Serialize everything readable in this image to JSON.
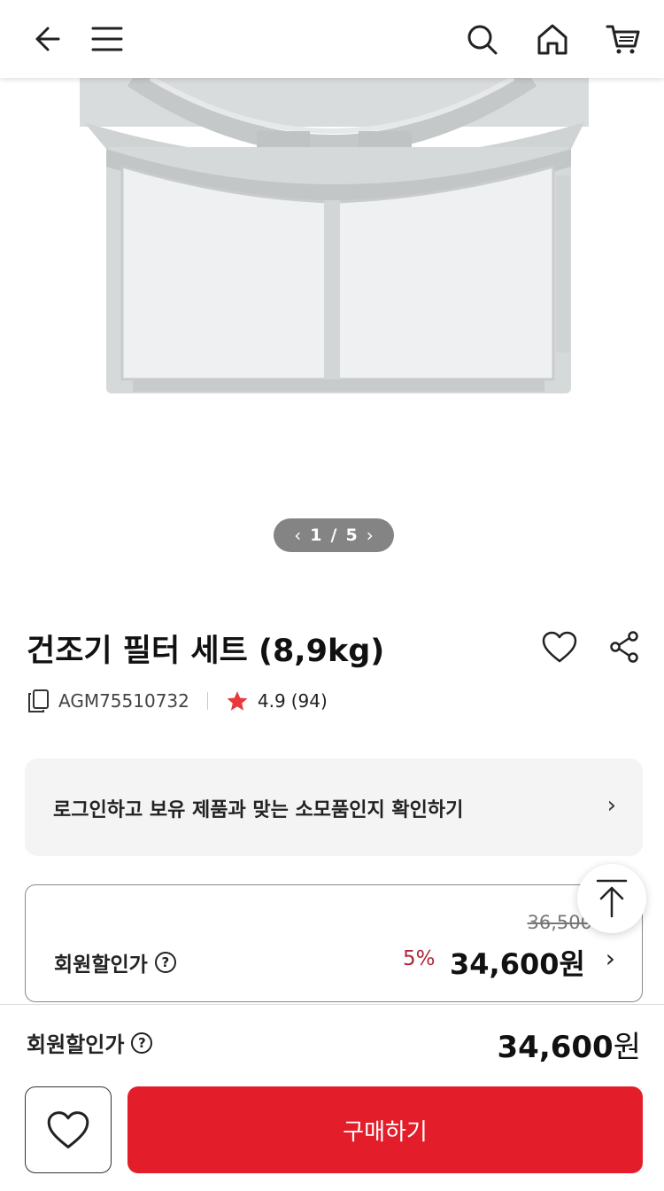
{
  "header": {
    "back_icon": "arrow-left-icon",
    "menu_icon": "hamburger-menu-icon",
    "search_icon": "search-icon",
    "home_icon": "home-icon",
    "cart_icon": "cart-icon"
  },
  "gallery": {
    "current": "1",
    "separator": "/",
    "total": "5",
    "prev": "‹",
    "next": "›"
  },
  "product": {
    "title": "건조기 필터 세트 (8,9kg)",
    "model_code": "AGM75510732",
    "rating": "4.9",
    "review_count": "(94)",
    "star_color": "#e8393f"
  },
  "login_banner": {
    "text": "로그인하고 보유 제품과 맞는 소모품인지 확인하기",
    "chevron": "›"
  },
  "price_card": {
    "original_price": "36,500",
    "label": "회원할인가",
    "help": "?",
    "discount_rate": "5%",
    "price": "34,600원",
    "chevron": "›"
  },
  "bottom_bar": {
    "label": "회원할인가",
    "help": "?",
    "price": "34,600",
    "currency": "원",
    "buy_label": "구매하기",
    "buy_color": "#e31e2a"
  }
}
